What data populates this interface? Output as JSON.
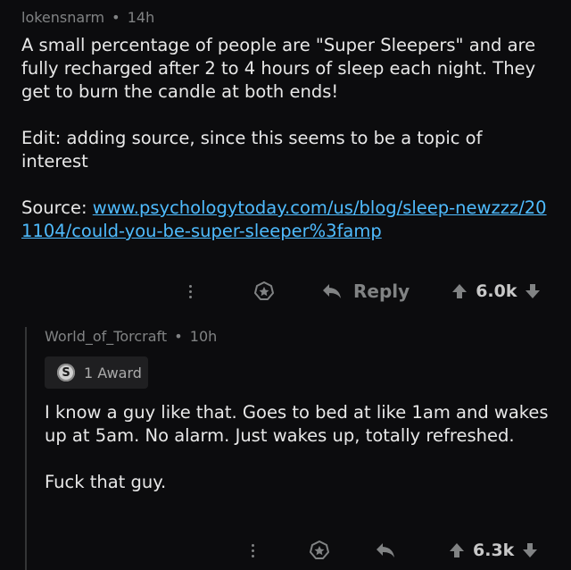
{
  "comments": [
    {
      "author": "lokensnarm",
      "separator": "•",
      "age": "14h",
      "paragraphs": [
        "A small percentage of people are \"Super Sleepers\" and are fully recharged after 2 to 4 hours of sleep each night. They get to burn the candle at both ends!",
        "Edit: adding source, since this seems to be a topic of interest"
      ],
      "source_label": "Source:",
      "source_link": "www.psychologytoday.com/us/blog/sleep-newzzz/201104/could-you-be-super-sleeper%3famp",
      "reply_label": "Reply",
      "score": "6.0k"
    },
    {
      "author": "World_of_Torcraft",
      "separator": "•",
      "age": "10h",
      "award_icon_letter": "S",
      "award_text": "1 Award",
      "paragraphs": [
        "I know a guy like that. Goes to bed at like 1am and wakes up at 5am. No alarm. Just wakes up, totally refreshed.",
        "Fuck that guy."
      ],
      "score": "6.3k"
    }
  ],
  "colors": {
    "background": "#0c0c0e",
    "text": "#e8e8e8",
    "meta": "#818384",
    "link": "#4fbcff",
    "award_badge_bg": "#1f1f21"
  },
  "icons": {
    "more": "more-vertical-icon",
    "award": "award-icon",
    "reply": "reply-arrow-icon",
    "upvote": "upvote-arrow-icon",
    "downvote": "downvote-arrow-icon",
    "silver_award": "silver-award-icon"
  }
}
